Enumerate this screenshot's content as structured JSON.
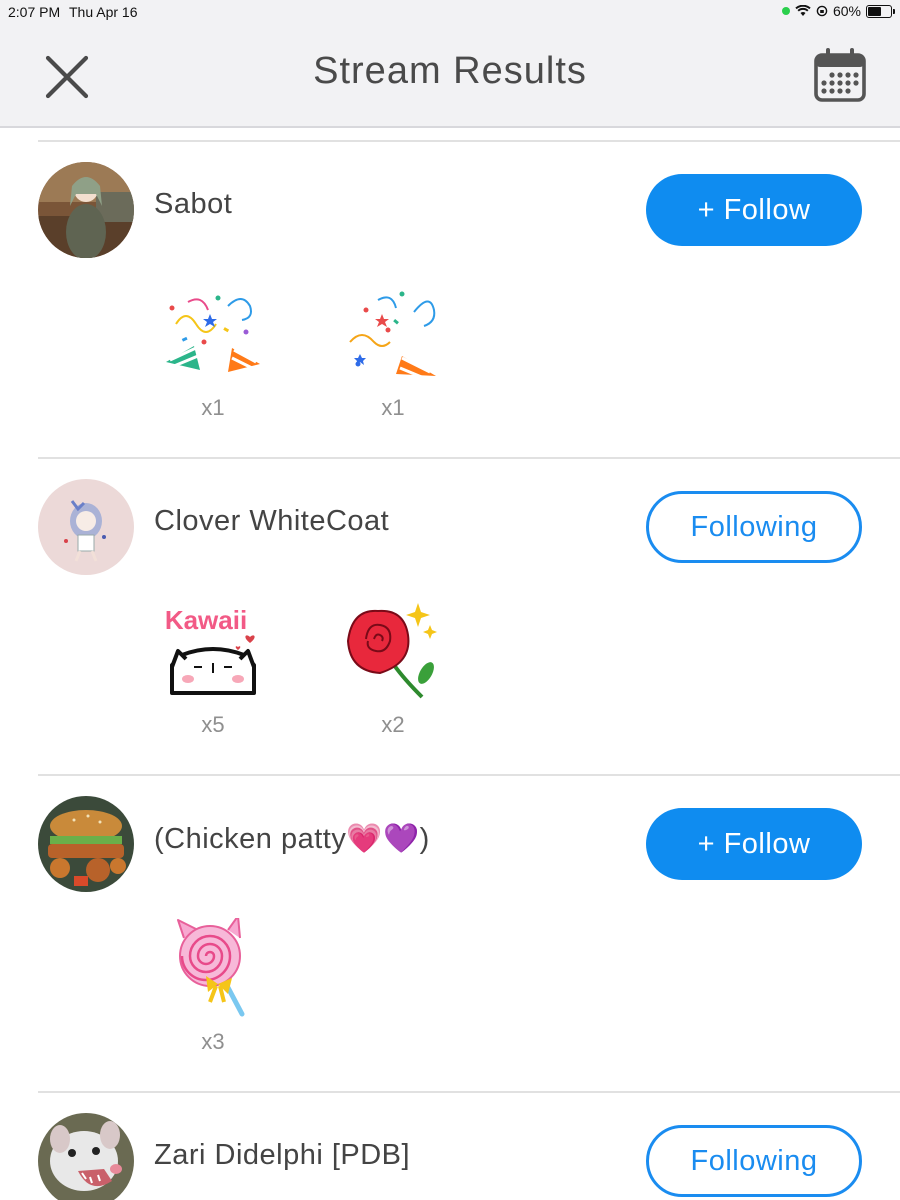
{
  "status": {
    "time": "2:07 PM",
    "date": "Thu Apr 16",
    "battery": "60%"
  },
  "header": {
    "title": "Stream Results"
  },
  "rows": [
    {
      "name": "Sabot",
      "button": "+ Follow",
      "gifts": [
        {
          "icon": "confetti-popper-icon",
          "count": "x1"
        },
        {
          "icon": "party-popper-icon",
          "count": "x1"
        }
      ]
    },
    {
      "name": "Clover WhiteCoat",
      "button": "Following",
      "gifts": [
        {
          "icon": "kawaii-cat-sticker",
          "label": "Kawaii",
          "count": "x5"
        },
        {
          "icon": "rose-icon",
          "count": "x2"
        }
      ]
    },
    {
      "name": "(Chicken patty💗💜)",
      "button": "+ Follow",
      "gifts": [
        {
          "icon": "lollipop-icon",
          "count": "x3"
        }
      ]
    },
    {
      "name": "Zari Didelphi [PDB]",
      "button": "Following",
      "gifts": []
    }
  ],
  "colors": {
    "accent": "#0f8cf0",
    "background": "#ffffff",
    "header": "#f2f2f4"
  }
}
